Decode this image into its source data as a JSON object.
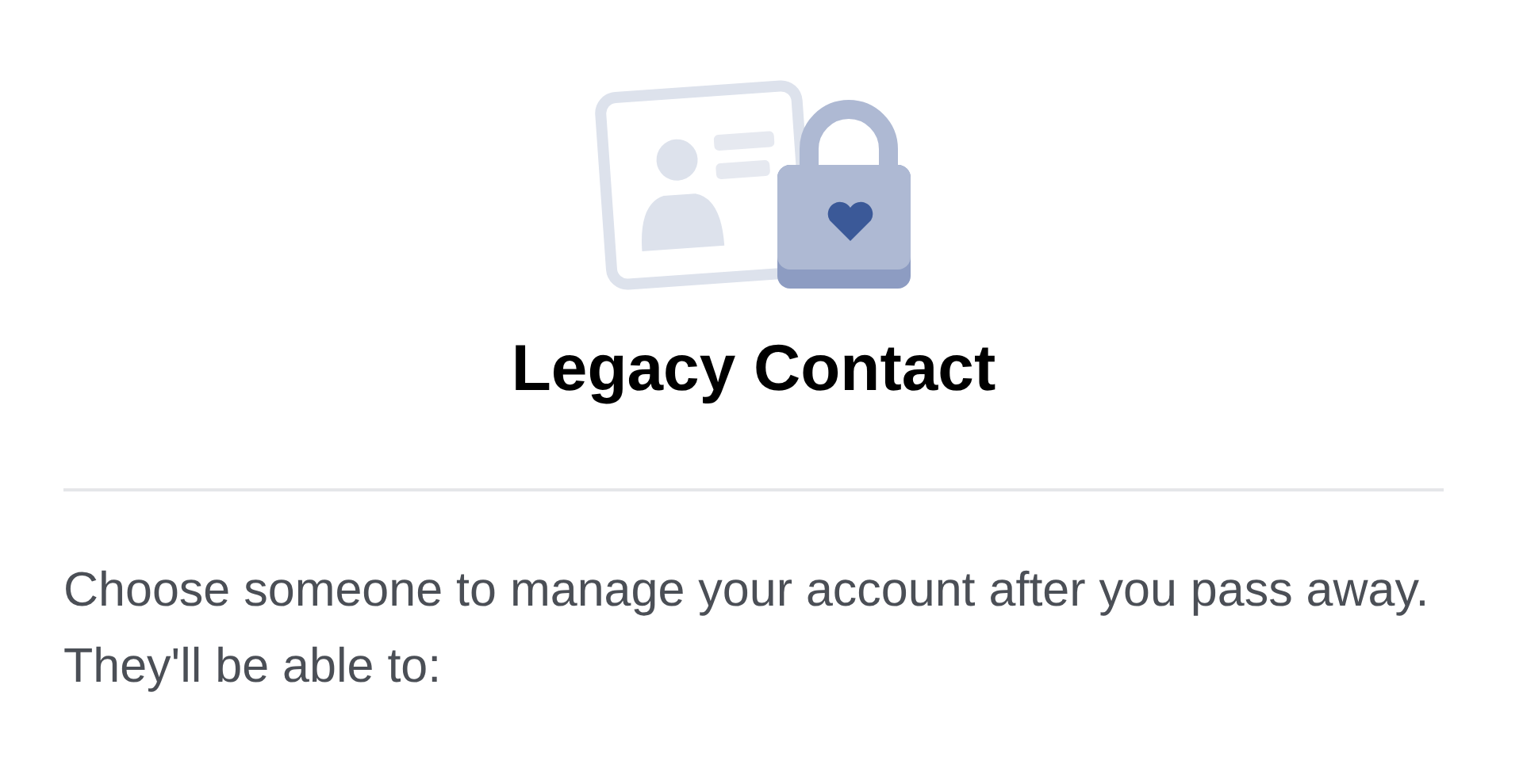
{
  "title": "Legacy Contact",
  "description": "Choose someone to manage your account after you pass away. They'll be able to:"
}
